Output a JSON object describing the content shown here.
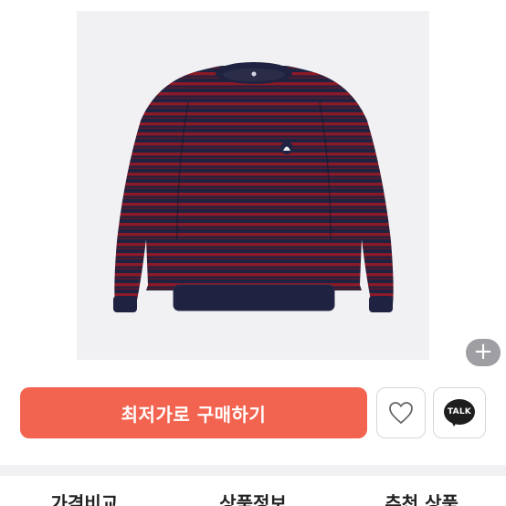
{
  "product": {
    "image_alt": "striped crewneck sweater",
    "zoom_label": "+"
  },
  "actions": {
    "buy_label": "최저가로 구매하기",
    "talk_label": "TALK"
  },
  "tabs": [
    {
      "label": "가격비교"
    },
    {
      "label": "상품정보"
    },
    {
      "label": "추천 상품"
    }
  ],
  "colors": {
    "accent": "#f26450",
    "sweater_navy": "#1f2240",
    "sweater_red": "#8a1a28",
    "background_gray": "#f1f1f3"
  }
}
